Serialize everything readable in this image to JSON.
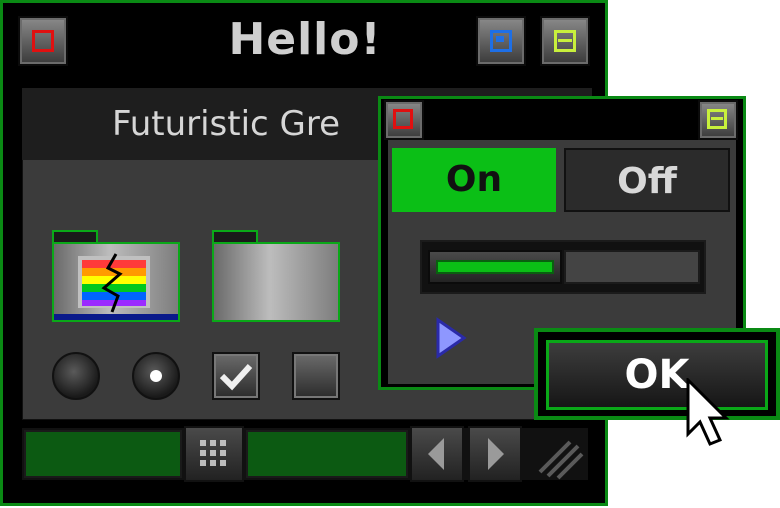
{
  "window": {
    "title": "Hello!"
  },
  "inner_panel": {
    "title": "Futuristic Gre"
  },
  "popup": {
    "toggle": {
      "on_label": "On",
      "off_label": "Off",
      "selected": "On"
    },
    "slider": {
      "value_fraction": 0.48
    }
  },
  "ok_dialog": {
    "button_label": "OK"
  },
  "colors": {
    "accent_green": "#0bbf16",
    "frame_green": "#0a8a14",
    "close_red": "#e01010",
    "save_blue": "#1e6fe6",
    "minimize_yellow": "#c8f03c"
  },
  "icons": [
    "close-icon",
    "save-icon",
    "minimize-icon",
    "folder-rainbow-icon",
    "folder-icon",
    "play-icon",
    "scroll-left-icon",
    "scroll-right-icon",
    "resize-grip-icon",
    "grip-dots-icon",
    "mouse-cursor-icon"
  ]
}
